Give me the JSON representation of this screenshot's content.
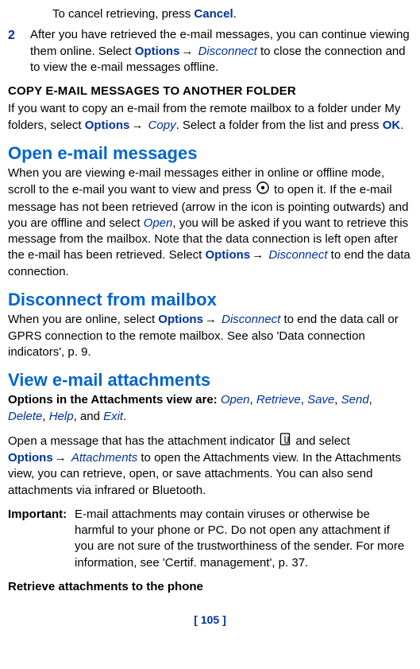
{
  "intro": {
    "cancel_line_pre": "To cancel retrieving, press ",
    "cancel_word": "Cancel",
    "step2_num": "2",
    "step2_a": "After you have retrieved the e-mail messages, you can continue viewing them online. Select ",
    "options_word": "Options",
    "arrow": "→",
    "disconnect_word": "Disconnect",
    "step2_b": " to close the connection and to view the e-mail messages offline."
  },
  "copy": {
    "heading": "COPY E-MAIL MESSAGES TO ANOTHER FOLDER",
    "p_a": "If you want to copy an e-mail from the remote mailbox to a folder under My folders, select ",
    "copy_word": "Copy",
    "p_b": ". Select a folder from the list and press ",
    "ok_word": "OK",
    "p_c": "."
  },
  "open": {
    "heading": "Open e-mail messages",
    "p_a": "When you are viewing e-mail messages either in online or offline mode, scroll to the e-mail you want to view and press ",
    "p_b": " to open it. If the e-mail message has not been retrieved (arrow in the icon is pointing outwards) and you are offline and select ",
    "open_word": "Open",
    "p_c": ", you will be asked if you want to retrieve this message from the mailbox. Note that the data connection is left open after the e-mail has been retrieved. Select ",
    "p_d": " to end the data connection."
  },
  "disconnect": {
    "heading": "Disconnect from mailbox",
    "p_a": "When you are online, select ",
    "p_b": " to end the data call or GPRS connection to the remote mailbox. See also 'Data connection indicators', p. 9."
  },
  "attach": {
    "heading": "View e-mail attachments",
    "opts_lead": "Options in the Attachments view are: ",
    "o1": "Open",
    "o2": "Retrieve",
    "o3": "Save",
    "o4": "Send",
    "o5": "Delete",
    "o6": "Help",
    "o7": "Exit",
    "sep": ", ",
    "and": ", and ",
    "period": ".",
    "p_a": "Open a message that has the attachment indicator ",
    "p_b": " and select ",
    "attachments_word": "Attachments",
    "p_c": " to open the Attachments view. In the Attachments view, you can retrieve, open, or save attachments. You can also send attachments via infrared or Bluetooth.",
    "important_label": "Important:",
    "important_text": "E-mail attachments may contain viruses or otherwise be harmful to your phone or PC. Do not open any attachment if you are not sure of the trustworthiness of the sender. For more information, see 'Certif. management', p. 37.",
    "retrieve_head": "Retrieve attachments to the phone"
  },
  "footer": "[ 105 ]"
}
